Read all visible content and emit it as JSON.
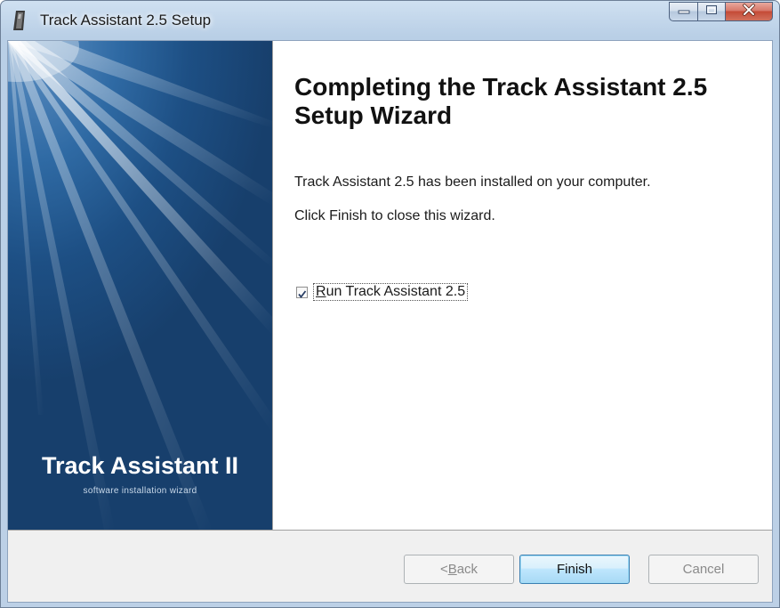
{
  "window": {
    "title": "Track Assistant 2.5 Setup",
    "icon": "setup-app-icon",
    "caption_buttons": [
      "minimize-icon",
      "maximize-icon",
      "close-icon"
    ]
  },
  "banner": {
    "title": "Track Assistant II",
    "subtitle": "software installation wizard",
    "colors": {
      "dark": "#173f6c",
      "mid": "#2f6aa4",
      "light": "#5d8fc2"
    }
  },
  "content": {
    "heading": "Completing the Track Assistant 2.5 Setup Wizard",
    "installed_text": "Track Assistant 2.5 has been installed on your computer.",
    "finish_text": "Click Finish to close this wizard.",
    "run_checkbox": {
      "label_accesskey": "R",
      "label_rest": "un Track Assistant 2.5",
      "checked": true
    }
  },
  "footer": {
    "back": {
      "prefix": "< ",
      "accesskey": "B",
      "rest": "ack",
      "enabled": false
    },
    "finish": {
      "label": "Finish",
      "default": true
    },
    "cancel": {
      "label": "Cancel",
      "enabled": false
    }
  }
}
